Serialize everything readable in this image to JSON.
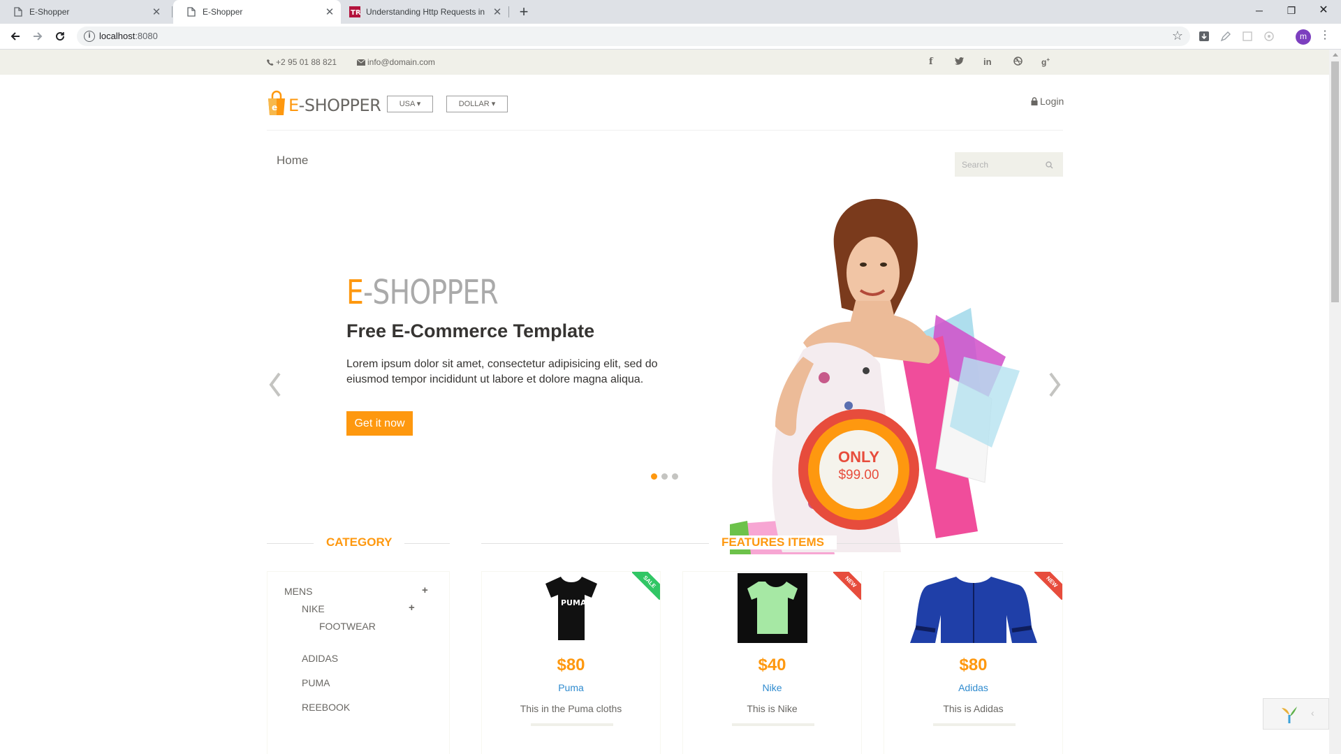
{
  "browser": {
    "tabs": [
      {
        "title": "E-Shopper",
        "active": false
      },
      {
        "title": "E-Shopper",
        "active": true
      },
      {
        "title": "Understanding Http Requests in",
        "active": false
      }
    ],
    "url_host": "localhost",
    "url_port": ":8080",
    "avatar_letter": "m"
  },
  "topbar": {
    "phone": "+2 95 01 88 821",
    "email": "info@domain.com",
    "social": [
      "f",
      "t",
      "in",
      "dribbble",
      "g+"
    ]
  },
  "header": {
    "logo_prefix": "E",
    "logo_rest": "-SHOPPER",
    "country": "USA",
    "currency": "DOLLAR",
    "login": "Login"
  },
  "nav": {
    "home": "Home",
    "search_placeholder": "Search"
  },
  "slider": {
    "title_prefix": "E",
    "title_rest": "-SHOPPER",
    "subtitle": "Free E-Commerce Template",
    "text": "Lorem ipsum dolor sit amet, consectetur adipisicing elit, sed do eiusmod tempor incididunt ut labore et dolore magna aliqua.",
    "button": "Get it now",
    "badge_only": "ONLY",
    "badge_price": "$99.00",
    "slide_count": 3,
    "active_slide": 1
  },
  "category": {
    "title": "CATEGORY",
    "mens": "MENS",
    "nike": "NIKE",
    "footwear": "FOOTWEAR",
    "items": [
      "ADIDAS",
      "PUMA",
      "REEBOOK"
    ]
  },
  "features": {
    "title": "FEATURES ITEMS",
    "products": [
      {
        "price": "$80",
        "name": "Puma",
        "desc": "This in the Puma cloths",
        "ribbon": "SALE",
        "ribbon_color": "#31c665"
      },
      {
        "price": "$40",
        "name": "Nike",
        "desc": "This is Nike",
        "ribbon": "NEW",
        "ribbon_color": "#e74c3c"
      },
      {
        "price": "$80",
        "name": "Adidas",
        "desc": "This is Adidas",
        "ribbon": "NEW",
        "ribbon_color": "#e74c3c"
      }
    ]
  },
  "colors": {
    "accent": "#fe980f",
    "topbar_bg": "#f0f0e9",
    "link": "#2f8bcf"
  }
}
